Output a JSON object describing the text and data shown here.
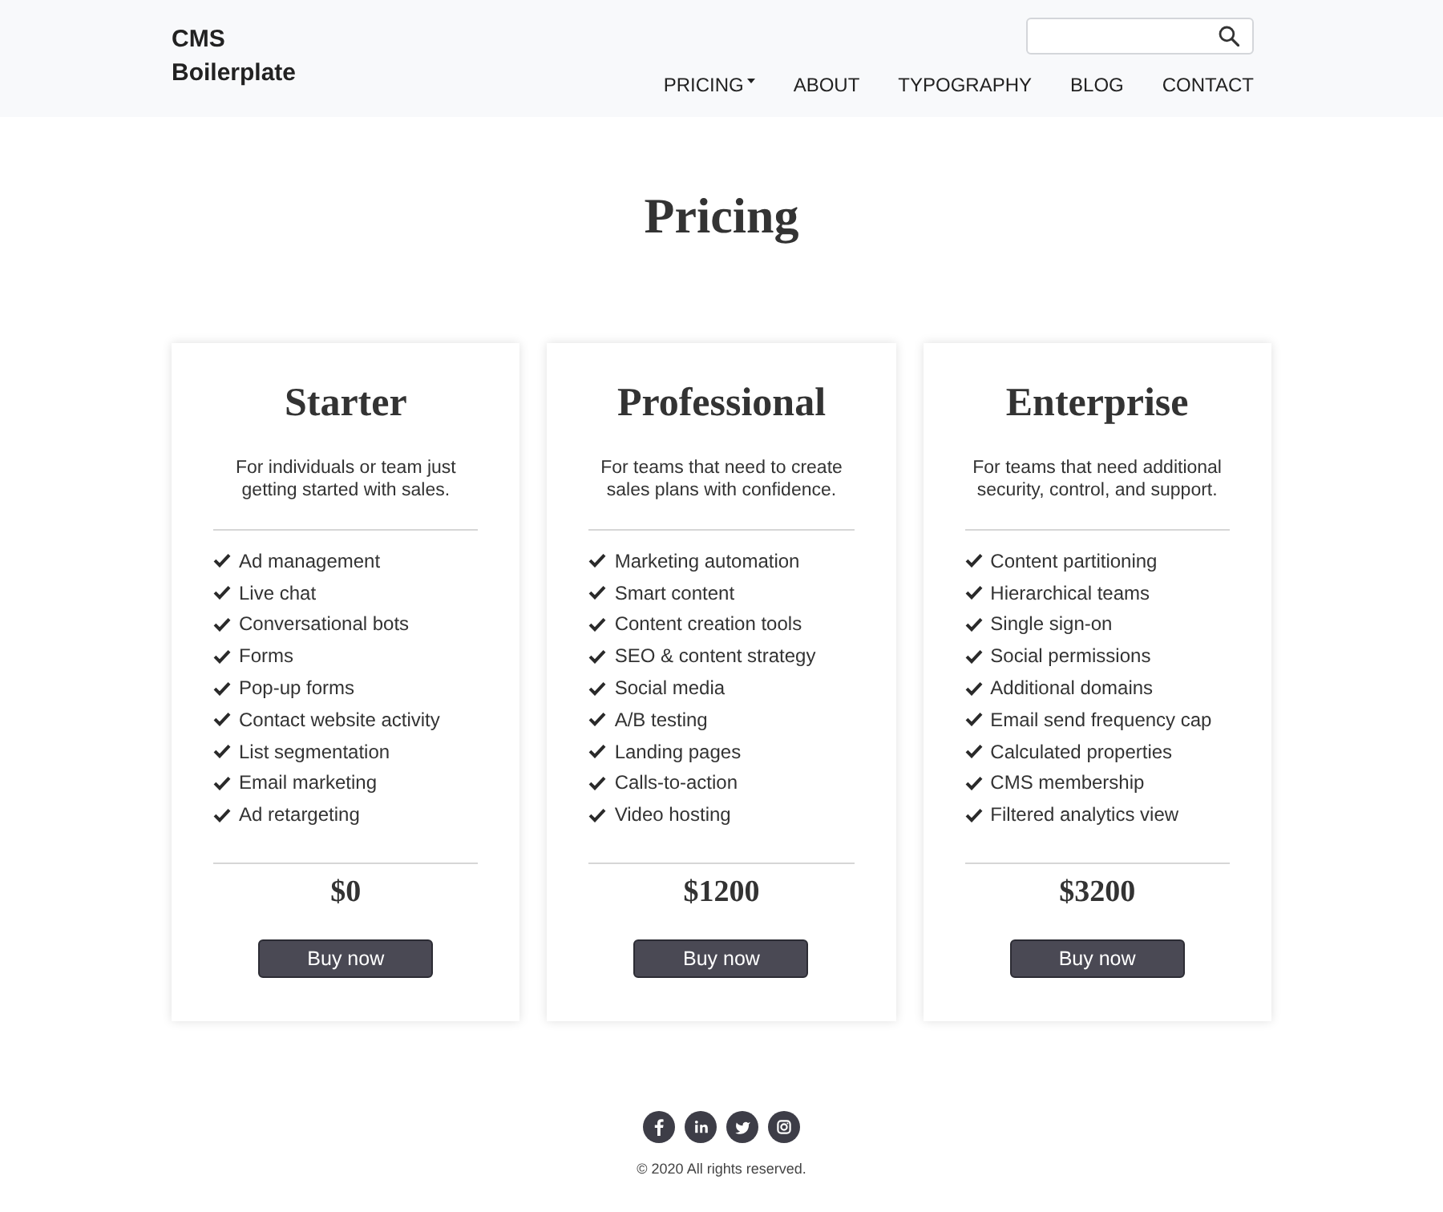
{
  "header": {
    "logo": "CMS Boilerplate",
    "nav": [
      {
        "label": "PRICING",
        "dropdown": true
      },
      {
        "label": "ABOUT",
        "dropdown": false
      },
      {
        "label": "TYPOGRAPHY",
        "dropdown": false
      },
      {
        "label": "BLOG",
        "dropdown": false
      },
      {
        "label": "CONTACT",
        "dropdown": false
      }
    ]
  },
  "title": "Pricing",
  "plans": [
    {
      "name": "Starter",
      "description": "For individuals or team just getting started with sales.",
      "features": [
        "Ad management",
        "Live chat",
        "Conversational bots",
        "Forms",
        "Pop-up forms",
        "Contact website activity",
        "List segmentation",
        "Email marketing",
        "Ad retargeting"
      ],
      "price": "$0",
      "button": "Buy now"
    },
    {
      "name": "Professional",
      "description": "For teams that need to create sales plans with confidence.",
      "features": [
        "Marketing automation",
        "Smart content",
        "Content creation tools",
        "SEO & content strategy",
        "Social media",
        "A/B testing",
        "Landing pages",
        "Calls-to-action",
        "Video hosting"
      ],
      "price": "$1200",
      "button": "Buy now"
    },
    {
      "name": "Enterprise",
      "description": "For teams that need additional security, control, and support.",
      "features": [
        "Content partitioning",
        "Hierarchical teams",
        "Single sign-on",
        "Social permissions",
        "Additional domains",
        "Email send frequency cap",
        "Calculated properties",
        "CMS membership",
        "Filtered analytics view"
      ],
      "price": "$3200",
      "button": "Buy now"
    }
  ],
  "footer": {
    "social": [
      {
        "kind": "facebook"
      },
      {
        "kind": "linkedin"
      },
      {
        "kind": "twitter"
      },
      {
        "kind": "instagram"
      }
    ],
    "copyright": "© 2020 All rights reserved."
  }
}
